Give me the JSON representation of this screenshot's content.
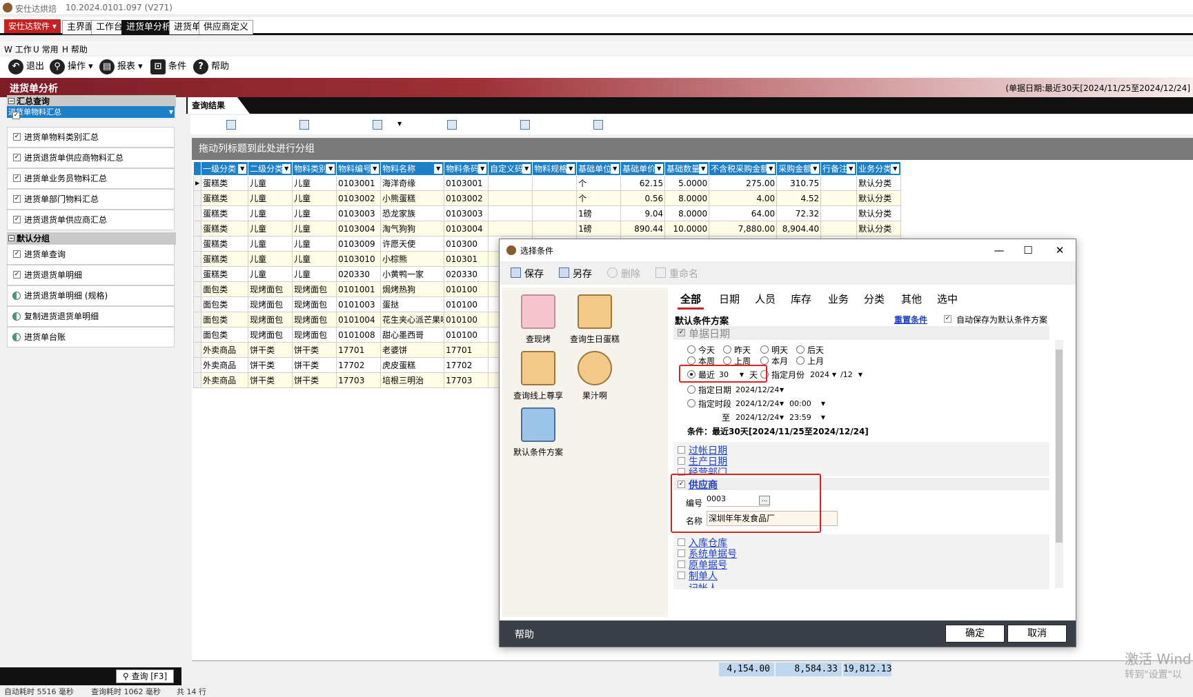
{
  "window": {
    "app": "安仕达烘焙",
    "version": "10.2024.0101.097 (V271)"
  },
  "brand": "安仕达软件",
  "tabs": [
    "主界面",
    "工作台",
    "进货单分析",
    "进货单",
    "供应商定义"
  ],
  "menu": [
    "工作",
    "常用",
    "帮助"
  ],
  "toolbar": {
    "exit": "退出",
    "operate": "操作",
    "report": "报表",
    "condition": "条件",
    "help": "帮助"
  },
  "page_title": "进货单分析",
  "date_info": "(单据日期:最近30天[2024/11/25至2024/12/24]",
  "left": {
    "group1": "汇总查询",
    "items1": [
      "进货单物料汇总",
      "进货单物料类别汇总",
      "进货退货单供应商物料汇总",
      "进货单业务员物料汇总",
      "进货单部门物料汇总",
      "进货退货单供应商汇总"
    ],
    "group2": "默认分组",
    "items2": [
      "进货单查询",
      "进货退货单明细",
      "进货退货单明细 (规格)",
      "复制进货退货单明细",
      "进货单台账"
    ],
    "query_btn": "查询 [F3]"
  },
  "results_tab": "查询结果",
  "group_hint": "拖动列标题到此处进行分组",
  "grid": {
    "columns": [
      "一级分类",
      "二级分类",
      "物料类别",
      "物料编号",
      "物料名称",
      "物料条码",
      "自定义码",
      "物料规格",
      "基础单位",
      "基础单价",
      "基础数量",
      "不含税采购金额",
      "采购金额",
      "行备注",
      "业务分类"
    ],
    "rows": [
      [
        "蛋糕类",
        "儿童",
        "儿童",
        "0103001",
        "海洋奇缘",
        "0103001",
        "",
        "",
        "个",
        "62.15",
        "5.0000",
        "275.00",
        "310.75",
        "",
        "默认分类"
      ],
      [
        "蛋糕类",
        "儿童",
        "儿童",
        "0103002",
        "小熊蛋糕",
        "0103002",
        "",
        "",
        "个",
        "0.56",
        "8.0000",
        "4.00",
        "4.52",
        "",
        "默认分类"
      ],
      [
        "蛋糕类",
        "儿童",
        "儿童",
        "0103003",
        "恐龙家族",
        "0103003",
        "",
        "",
        "1磅",
        "9.04",
        "8.0000",
        "64.00",
        "72.32",
        "",
        "默认分类"
      ],
      [
        "蛋糕类",
        "儿童",
        "儿童",
        "0103004",
        "淘气狗狗",
        "0103004",
        "",
        "",
        "1磅",
        "890.44",
        "10.0000",
        "7,880.00",
        "8,904.40",
        "",
        "默认分类"
      ],
      [
        "蛋糕类",
        "儿童",
        "儿童",
        "0103009",
        "许愿天使",
        "010300",
        "",
        "",
        "",
        "",
        "",
        "",
        "",
        "",
        ""
      ],
      [
        "蛋糕类",
        "儿童",
        "儿童",
        "0103010",
        "小棕熊",
        "010301",
        "",
        "",
        "",
        "",
        "",
        "",
        "",
        "",
        ""
      ],
      [
        "蛋糕类",
        "儿童",
        "儿童",
        "020330",
        "小黄鸭一家",
        "020330",
        "",
        "",
        "",
        "",
        "",
        "",
        "",
        "",
        ""
      ],
      [
        "面包类",
        "现烤面包",
        "现烤面包",
        "0101001",
        "焗烤热狗",
        "010100",
        "",
        "",
        "",
        "",
        "",
        "",
        "",
        "",
        ""
      ],
      [
        "面包类",
        "现烤面包",
        "现烤面包",
        "0101003",
        "蛋挞",
        "010100",
        "",
        "",
        "",
        "",
        "",
        "",
        "",
        "",
        ""
      ],
      [
        "面包类",
        "现烤面包",
        "现烤面包",
        "0101004",
        "花生夹心派芒果味",
        "010100",
        "",
        "",
        "",
        "",
        "",
        "",
        "",
        "",
        ""
      ],
      [
        "面包类",
        "现烤面包",
        "现烤面包",
        "0101008",
        "甜心墨西哥",
        "010100",
        "",
        "",
        "",
        "",
        "",
        "",
        "",
        "",
        ""
      ],
      [
        "外卖商品",
        "饼干类",
        "饼干类",
        "17701",
        "老婆饼",
        "17701",
        "",
        "",
        "",
        "",
        "",
        "",
        "",
        "",
        ""
      ],
      [
        "外卖商品",
        "饼干类",
        "饼干类",
        "17702",
        "虎皮蛋糕",
        "17702",
        "",
        "",
        "",
        "",
        "",
        "",
        "",
        "",
        ""
      ],
      [
        "外卖商品",
        "饼干类",
        "饼干类",
        "17703",
        "培根三明治",
        "17703",
        "",
        "",
        "",
        "",
        "",
        "",
        "",
        "",
        ""
      ]
    ]
  },
  "totals": [
    "4,154.00",
    "8,584.33",
    "19,812.13"
  ],
  "status": {
    "auto": "自动耗时 5516 毫秒",
    "query": "查询耗时 1062 毫秒",
    "count": "共 14 行"
  },
  "watermark": {
    "line1": "激活 Wind",
    "line2": "转到\"设置\"以"
  },
  "dialog": {
    "title": "选择条件",
    "tools": [
      "保存",
      "另存",
      "删除",
      "重命名"
    ],
    "tiles": [
      "查现烤",
      "查询生日蛋糕",
      "查询线上尊享",
      "果汁啊",
      "默认条件方案"
    ],
    "tabs": [
      "全部",
      "日期",
      "人员",
      "库存",
      "业务",
      "分类",
      "其他",
      "选中"
    ],
    "scheme_label": "默认条件方案",
    "reset": "重置条件",
    "autosave": "自动保存为默认条件方案",
    "section_date": "单据日期",
    "quick": [
      "今天",
      "昨天",
      "明天",
      "后天",
      "本周",
      "上周",
      "本月",
      "上月"
    ],
    "recent_label": "最近",
    "recent_value": "30",
    "recent_unit": "天",
    "month_label": "指定月份",
    "year": "2024",
    "month": "/12",
    "specified_date": "指定日期",
    "date_value": "2024/12/24",
    "specified_period": "指定时段",
    "from_date": "2024/12/24",
    "from_time": "00:00",
    "to_label": "至",
    "to_date": "2024/12/24",
    "to_time": "23:59",
    "condition_text": "条件：最近30天[2024/11/25至2024/12/24]",
    "links1": [
      "过帐日期",
      "生产日期",
      "经营部门"
    ],
    "supplier_label": "供应商",
    "code_label": "编号",
    "code_value": "0003",
    "name_label": "名称",
    "name_value": "深圳年年发食品厂",
    "links2": [
      "入库仓库",
      "系统单据号",
      "原单据号",
      "制单人",
      "记帐人"
    ],
    "footer_help": "帮助",
    "ok": "确定",
    "cancel": "取消"
  },
  "colors": {
    "accent": "#1e7fc9",
    "brand": "#c52121",
    "highlight": "#e02020"
  }
}
